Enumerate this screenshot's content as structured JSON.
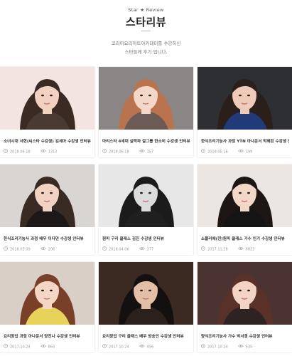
{
  "header": {
    "eyebrow": "Star ★ Review",
    "title": "스타리뷰",
    "desc_line1": "코리아요리아트아카데미를 수강하신",
    "desc_line2": "스타들께 후기 입니다."
  },
  "cards": [
    {
      "title": "소녀시대 서현(씨스타 수강생) 김세아 수강생 인터뷰",
      "date": "2018.06.18",
      "views": "1313",
      "photo": {
        "bg": "#f3e4e2",
        "skin": "#f1d2c1",
        "hair": "#3b2a24",
        "cloth": "#4a3a34"
      }
    },
    {
      "title": "마리스타 4세대 실력파 걸그룹 한소비 수강생 인터뷰",
      "date": "2018.06.18",
      "views": "157",
      "photo": {
        "bg": "#8a8686",
        "skin": "#f3d7c8",
        "hair": "#b9744f",
        "cloth": "#6b5a55"
      }
    },
    {
      "title": "한식조리기능사 과정 YTN 아나운서 박혜린 수강생 인터뷰",
      "date": "2018.05.16",
      "views": "199",
      "photo": {
        "bg": "#2d2f33",
        "skin": "#eecbb8",
        "hair": "#2a1f1b",
        "cloth": "#203a7a"
      }
    },
    {
      "title": "한식조리기능사 과정 배우 이다연 수강생 인터뷰",
      "date": "2018.05.09",
      "views": "206",
      "photo": {
        "bg": "#d9d5d2",
        "skin": "#f0d3c2",
        "hair": "#3a2a24",
        "cloth": "#1c1818"
      }
    },
    {
      "title": "원피 구리 클래스 김진 수강생 인터뷰",
      "date": "2018.04.06",
      "views": "377",
      "photo": {
        "bg": "#e7e7e7",
        "skin": "#dcdcdc",
        "hair": "#1b1b1b",
        "cloth": "#1f1f1f"
      }
    },
    {
      "title": "소믈리에(전)원피 클래스 가수 인기 수강생 인터뷰",
      "date": "2017.11.28",
      "views": "6823",
      "photo": {
        "bg": "#ece6e2",
        "skin": "#f2d6c6",
        "hair": "#1e1614",
        "cloth": "#141414"
      }
    },
    {
      "title": "요리창업 과정 아나운서 양진나 수강생 인터뷰",
      "date": "2017.10.24",
      "views": "863",
      "photo": {
        "bg": "#d9cfc7",
        "skin": "#f4d6c4",
        "hair": "#7a3f28",
        "cloth": "#e8d35a"
      }
    },
    {
      "title": "요리창업 구리 클래스 배우 방송인 수강생 인터뷰",
      "date": "2017.10.24",
      "views": "456",
      "photo": {
        "bg": "#3a2a22",
        "skin": "#e3c0a5",
        "hair": "#151010",
        "cloth": "#2a211d"
      }
    },
    {
      "title": "양식조리기능사 가수 박서경 수강생 인터뷰",
      "date": "2017.10.24",
      "views": "535",
      "photo": {
        "bg": "#4a3330",
        "skin": "#f3d4c4",
        "hair": "#5a3128",
        "cloth": "#2e2222"
      }
    }
  ]
}
